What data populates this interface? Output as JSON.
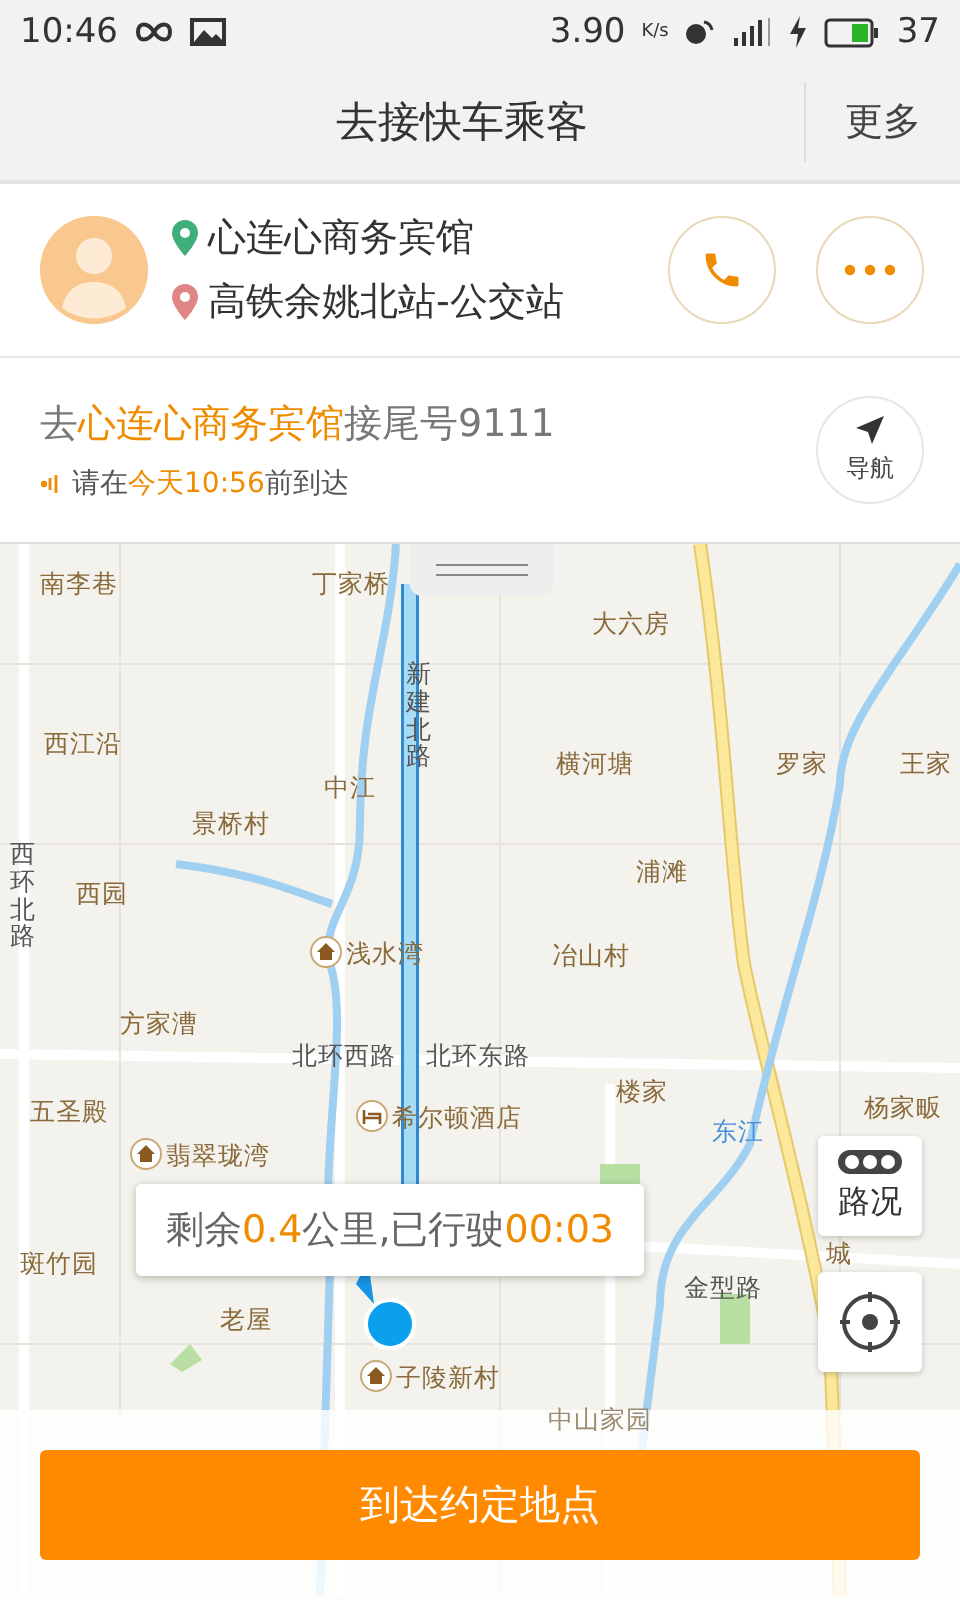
{
  "status_bar": {
    "time": "10:46",
    "speed": "3.90",
    "speed_unit": "K/s",
    "battery": "37"
  },
  "title_bar": {
    "title": "去接快车乘客",
    "more": "更多"
  },
  "passenger": {
    "pickup": "心连心商务宾馆",
    "dropoff": "高铁余姚北站-公交站"
  },
  "trip_info": {
    "headline": [
      {
        "text": "去",
        "highlight": false
      },
      {
        "text": "心连心商务宾馆",
        "highlight": true
      },
      {
        "text": "接尾号9111",
        "highlight": false
      }
    ],
    "deadline": [
      {
        "text": "请在",
        "highlight": false
      },
      {
        "text": "今天10:56",
        "highlight": true
      },
      {
        "text": "前到达",
        "highlight": false
      }
    ],
    "nav_label": "导航"
  },
  "map": {
    "labels": [
      {
        "text": "南李巷",
        "kind": "place"
      },
      {
        "text": "丁家桥",
        "kind": "place"
      },
      {
        "text": "大六房",
        "kind": "place"
      },
      {
        "text": "西江沿",
        "kind": "place"
      },
      {
        "text": "新建北路",
        "kind": "road-vertical"
      },
      {
        "text": "中江",
        "kind": "place"
      },
      {
        "text": "横河塘",
        "kind": "place"
      },
      {
        "text": "罗家",
        "kind": "place"
      },
      {
        "text": "王家",
        "kind": "place"
      },
      {
        "text": "西环北路",
        "kind": "road-vertical"
      },
      {
        "text": "景桥村",
        "kind": "place"
      },
      {
        "text": "西园",
        "kind": "place"
      },
      {
        "text": "浦滩",
        "kind": "place"
      },
      {
        "text": "浅水湾",
        "kind": "home"
      },
      {
        "text": "冶山村",
        "kind": "place"
      },
      {
        "text": "方家漕",
        "kind": "place"
      },
      {
        "text": "北环西路",
        "kind": "road"
      },
      {
        "text": "北环东路",
        "kind": "road"
      },
      {
        "text": "楼家",
        "kind": "place"
      },
      {
        "text": "五圣殿",
        "kind": "place"
      },
      {
        "text": "杨家畈",
        "kind": "place"
      },
      {
        "text": "希尔顿酒店",
        "kind": "hotel"
      },
      {
        "text": "东江",
        "kind": "water"
      },
      {
        "text": "翡翠珑湾",
        "kind": "home"
      },
      {
        "text": "斑竹园",
        "kind": "place"
      },
      {
        "text": "城",
        "kind": "place"
      },
      {
        "text": "金型路",
        "kind": "road"
      },
      {
        "text": "老屋",
        "kind": "place"
      },
      {
        "text": "子陵新村",
        "kind": "home"
      },
      {
        "text": "中山家园",
        "kind": "faded"
      }
    ],
    "trip_popup": [
      {
        "text": "剩余",
        "highlight": false
      },
      {
        "text": "0.4",
        "highlight": true
      },
      {
        "text": "公里,已行驶",
        "highlight": false
      },
      {
        "text": "00:03",
        "highlight": true
      }
    ],
    "traffic_label": "路况",
    "action_button": "到达约定地点"
  }
}
